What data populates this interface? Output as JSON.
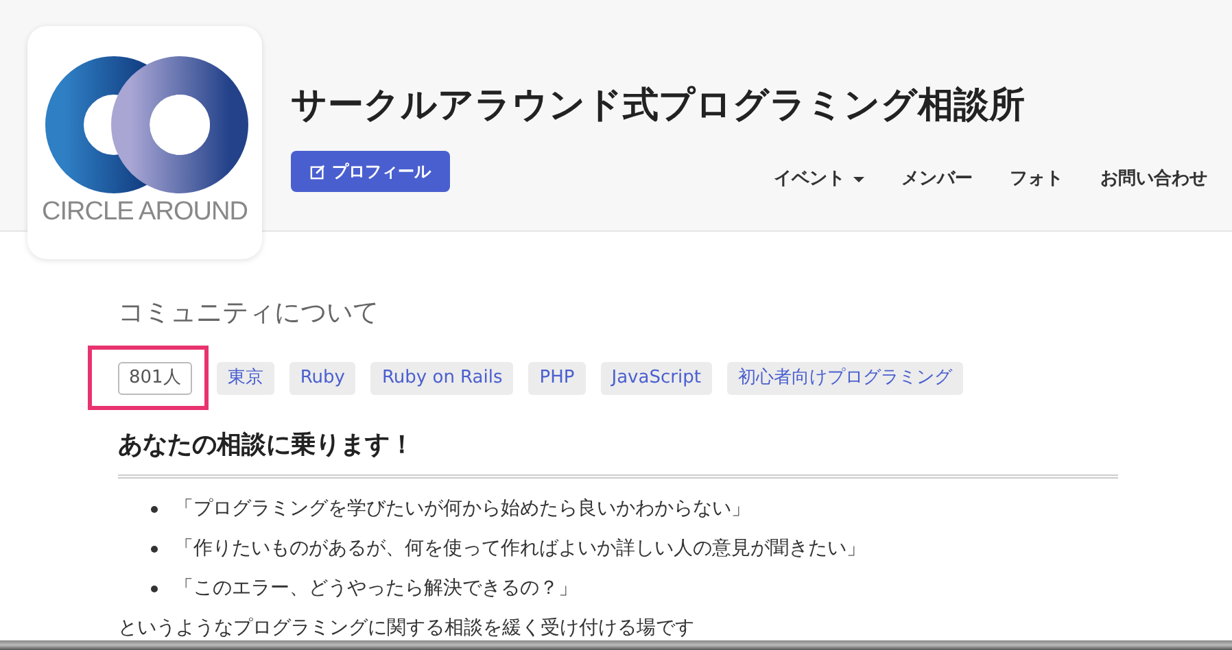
{
  "logo": {
    "text": "CIRCLE AROUND"
  },
  "title": "サークルアラウンド式プログラミング相談所",
  "profile_button": "プロフィール",
  "nav": [
    {
      "label": "イベント",
      "dropdown": true
    },
    {
      "label": "メンバー",
      "dropdown": false
    },
    {
      "label": "フォト",
      "dropdown": false
    },
    {
      "label": "お問い合わせ",
      "dropdown": false
    }
  ],
  "section_title": "コミュニティについて",
  "member_count": {
    "label": "801人",
    "highlighted": true
  },
  "tags": [
    "東京",
    "Ruby",
    "Ruby on Rails",
    "PHP",
    "JavaScript",
    "初心者向けプログラミング"
  ],
  "heading": "あなたの相談に乗ります！",
  "bullets": [
    "「プログラミングを学びたいが何から始めたら良いかわからない」",
    "「作りたいものがあるが、何を使って作ればよいか詳しい人の意見が聞きたい」",
    "「このエラー、どうやったら解決できるの？」"
  ],
  "paragraph": "というようなプログラミングに関する相談を緩く受け付ける場です"
}
